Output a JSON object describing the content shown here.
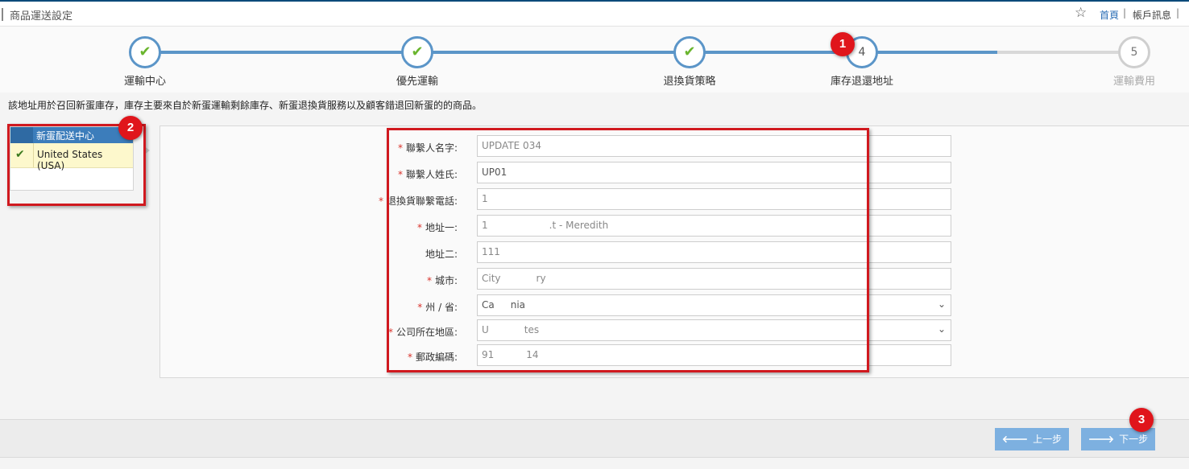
{
  "header": {
    "title": "商品運送設定",
    "breadcrumb_home": "首頁",
    "breadcrumb_sep": "|",
    "breadcrumb_account": "帳戶訊息",
    "breadcrumb_more": "|"
  },
  "wizard": {
    "steps": [
      {
        "label": "運輸中心",
        "state": "done"
      },
      {
        "label": "優先運輸",
        "state": "done"
      },
      {
        "label": "退換貨策略",
        "state": "done"
      },
      {
        "label": "庫存退還地址",
        "number": "4",
        "state": "current"
      },
      {
        "label": "運輸費用",
        "number": "5",
        "state": "todo"
      }
    ]
  },
  "description": "該地址用於召回新蛋庫存，庫存主要來自於新蛋運輸剩餘庫存、新蛋退換貨服務以及顧客錯退回新蛋的的商品。",
  "distribution_center": {
    "header": "新蛋配送中心",
    "items": [
      {
        "name": "United States (USA)",
        "selected": true
      }
    ]
  },
  "form": {
    "fields": [
      {
        "label": "聯繫人名字:",
        "required": true,
        "value": "UPDATE 034"
      },
      {
        "label": "聯繫人姓氏:",
        "required": true,
        "value": "UP01"
      },
      {
        "label": "退換貨聯繫電話:",
        "required": true,
        "value": "1"
      },
      {
        "label": "地址一:",
        "required": true,
        "value_start": "1",
        "value_end": ".t - Meredith"
      },
      {
        "label": "地址二:",
        "required": false,
        "value": "111"
      },
      {
        "label": "城市:",
        "required": true,
        "value_start": "City",
        "value_end": "ry"
      },
      {
        "label": "州 / 省:",
        "required": true,
        "value_start": "Ca",
        "value_end": "nia"
      },
      {
        "label": "公司所在地區:",
        "required": true,
        "value_start": "U",
        "value_end": "tes"
      },
      {
        "label": "郵政編碼:",
        "required": true,
        "value_start": "91",
        "value_end": "14"
      }
    ]
  },
  "buttons": {
    "prev": "上一步",
    "next": "下一步"
  },
  "annotations": [
    "1",
    "2",
    "3"
  ],
  "colors": {
    "accent": "#5b95c8",
    "check": "#6ab52e",
    "annotation": "#d0191f",
    "button": "#7db0e0"
  }
}
